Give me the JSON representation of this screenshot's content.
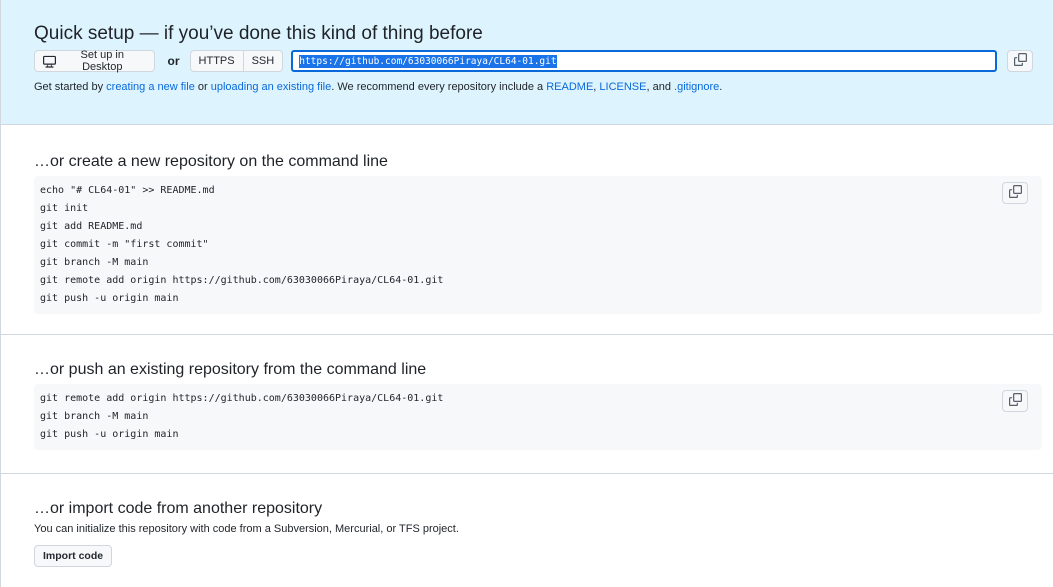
{
  "quick_setup": {
    "title": "Quick setup — if you’ve done this kind of thing before",
    "desktop_button": "Set up in Desktop",
    "or": "or",
    "protocols": [
      "HTTPS",
      "SSH"
    ],
    "url": "https://github.com/63030066Piraya/CL64-01.git",
    "help": {
      "prefix": "Get started by ",
      "link_new_file": "creating a new file",
      "mid": " or ",
      "link_upload": "uploading an existing file",
      "mid2": ". We recommend every repository include a ",
      "link_readme": "README",
      "comma": ", ",
      "link_license": "LICENSE",
      "and": ", and ",
      "link_gitignore": ".gitignore",
      "suffix": "."
    }
  },
  "new_repo": {
    "title": "…or create a new repository on the command line",
    "code": "echo \"# CL64-01\" >> README.md\ngit init\ngit add README.md\ngit commit -m \"first commit\"\ngit branch -M main\ngit remote add origin https://github.com/63030066Piraya/CL64-01.git\ngit push -u origin main"
  },
  "push_existing": {
    "title": "…or push an existing repository from the command line",
    "code": "git remote add origin https://github.com/63030066Piraya/CL64-01.git\ngit branch -M main\ngit push -u origin main"
  },
  "import": {
    "title": "…or import code from another repository",
    "description": "You can initialize this repository with code from a Subversion, Mercurial, or TFS project.",
    "button": "Import code"
  },
  "icons": {
    "desktop": "desktop-icon",
    "copy": "copy-icon"
  },
  "colors": {
    "accent": "#0969da",
    "quick_setup_bg": "#ddf4ff",
    "code_bg": "#f6f8fa"
  }
}
